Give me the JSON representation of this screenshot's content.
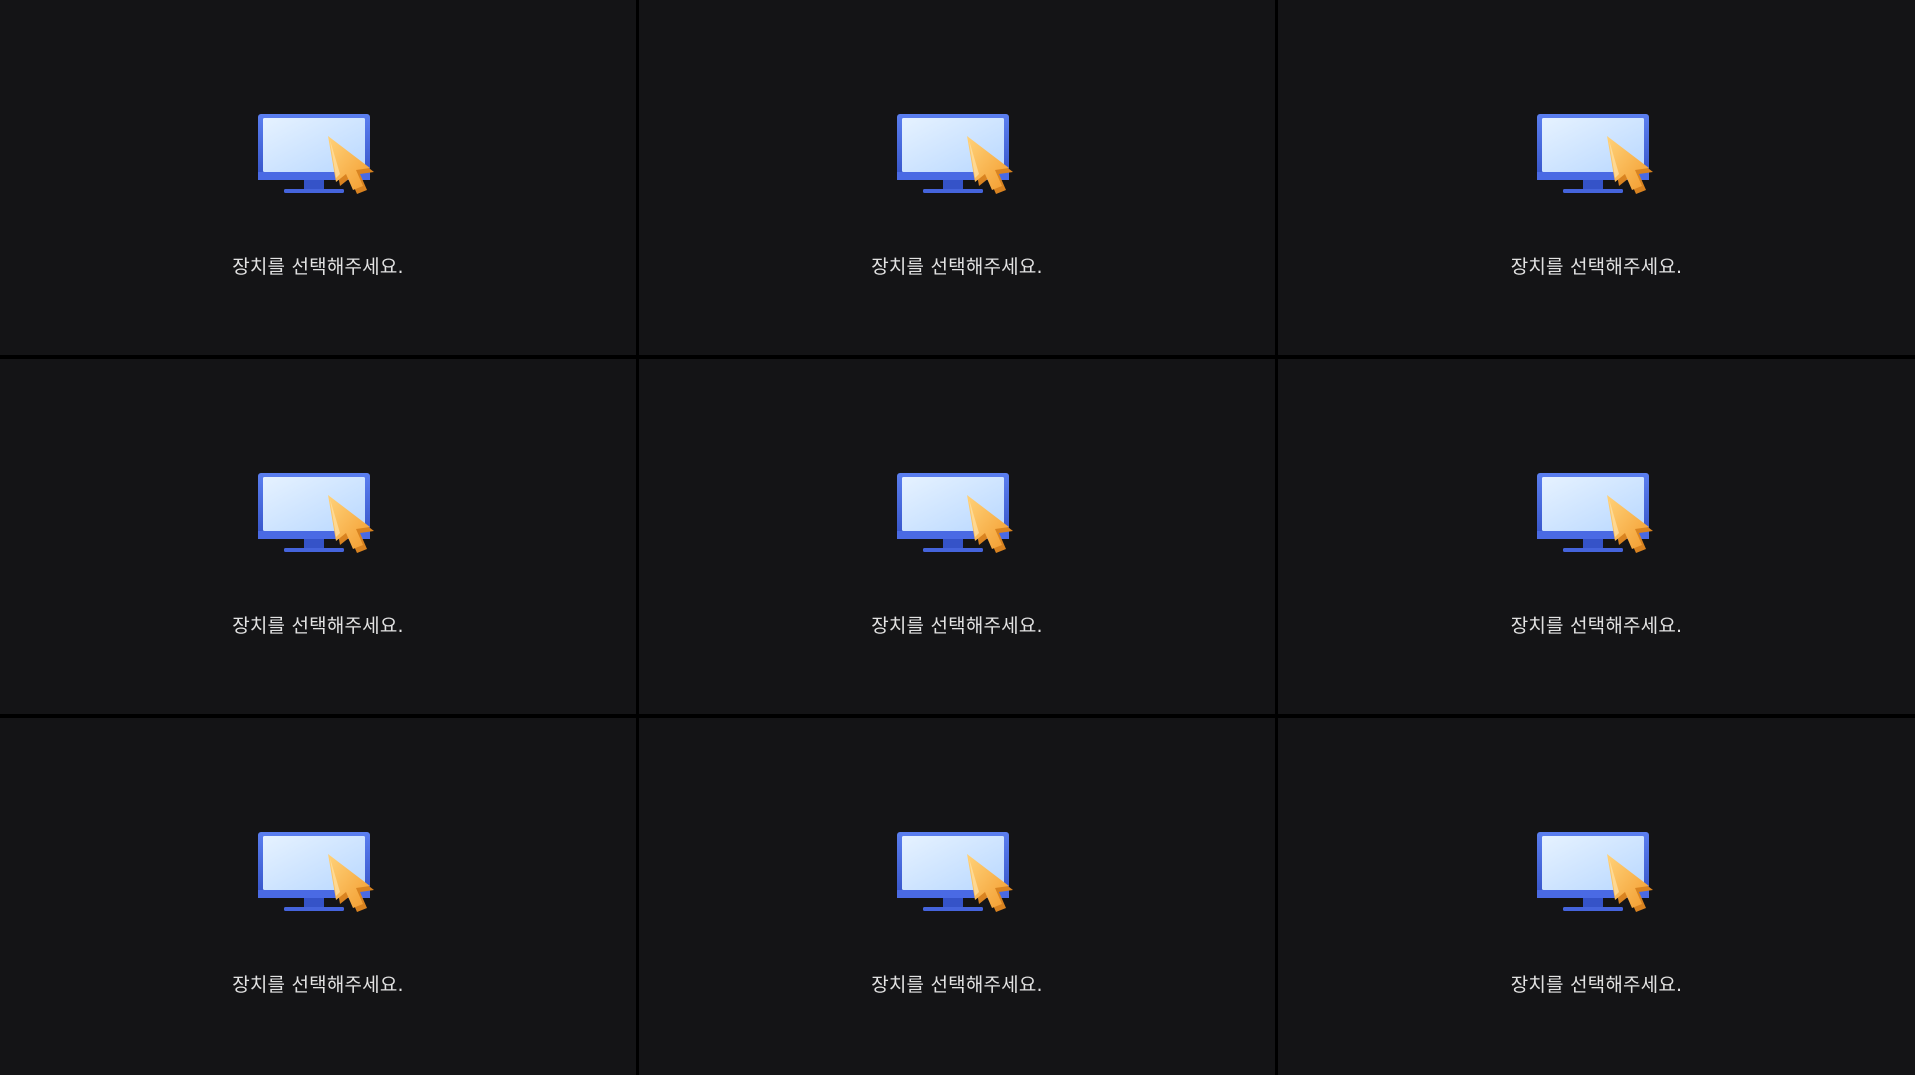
{
  "layout": {
    "rows": 3,
    "columns": 3
  },
  "colors": {
    "tile_background": "#141416",
    "divider": "#000000",
    "message_text": "#e2e2e2",
    "monitor_frame": "#3f63d9",
    "monitor_screen": "#cfe6ff",
    "cursor_fill": "#f7b347",
    "cursor_shade": "#e08d22"
  },
  "tiles": [
    {
      "icon": "monitor-select-icon",
      "message": "장치를 선택해주세요."
    },
    {
      "icon": "monitor-select-icon",
      "message": "장치를 선택해주세요."
    },
    {
      "icon": "monitor-select-icon",
      "message": "장치를 선택해주세요."
    },
    {
      "icon": "monitor-select-icon",
      "message": "장치를 선택해주세요."
    },
    {
      "icon": "monitor-select-icon",
      "message": "장치를 선택해주세요."
    },
    {
      "icon": "monitor-select-icon",
      "message": "장치를 선택해주세요."
    },
    {
      "icon": "monitor-select-icon",
      "message": "장치를 선택해주세요."
    },
    {
      "icon": "monitor-select-icon",
      "message": "장치를 선택해주세요."
    },
    {
      "icon": "monitor-select-icon",
      "message": "장치를 선택해주세요."
    }
  ]
}
